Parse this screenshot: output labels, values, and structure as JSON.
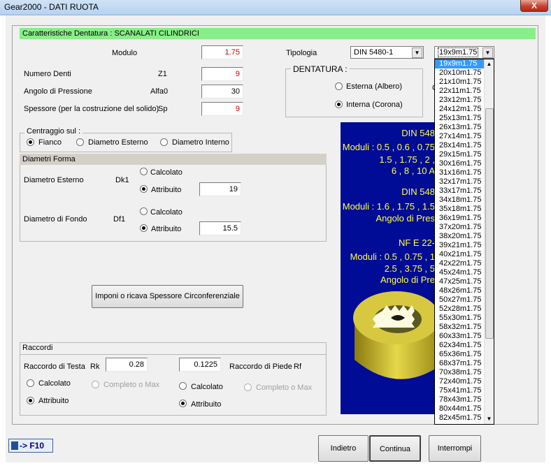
{
  "window": {
    "title": "Gear2000 - DATI RUOTA",
    "close_label": "X"
  },
  "header": {
    "section_title": "Caratteristiche Dentatura : SCANALATI CILINDRICI"
  },
  "fields": {
    "modulo": {
      "label": "Modulo",
      "value": "1.75"
    },
    "numero_denti": {
      "label": "Numero Denti",
      "symbol": "Z1",
      "value": "9"
    },
    "angolo_pressione": {
      "label": "Angolo di Pressione",
      "symbol": "Alfa0",
      "value": "30"
    },
    "spessore": {
      "label": "Spessore (per la costruzione del solido)",
      "symbol": "Sp",
      "value": "9"
    }
  },
  "tipologia": {
    "label": "Tipologia",
    "standard": "DIN 5480-1",
    "size": "19x9m1.75"
  },
  "dentatura": {
    "label": "DENTATURA :",
    "option_esterna": "Esterna (Albero)",
    "option_interna": "Interna (Corona)",
    "selected": "Interna (Corona)",
    "partial_label": "C"
  },
  "centraggio": {
    "label": "Centraggio sul :",
    "option_fianco": "Fianco",
    "option_esterno": "Diametro Esterno",
    "option_interno": "Diametro Interno",
    "selected": "Fianco"
  },
  "diametri": {
    "title": "Diametri Forma",
    "esterno": {
      "label": "Diametro Esterno",
      "symbol": "Dk1",
      "opt_calc": "Calcolato",
      "opt_attr": "Attribuito",
      "selected": "Attribuito",
      "value": "19"
    },
    "fondo": {
      "label": "Diametro di Fondo",
      "symbol": "Df1",
      "opt_calc": "Calcolato",
      "opt_attr": "Attribuito",
      "selected": "Attribuito",
      "value": "15.5"
    }
  },
  "imponi_button": "Imponi o ricava Spessore Circonferenziale",
  "raccordi": {
    "title": "Raccordi",
    "testa": {
      "label": "Raccordo di Testa",
      "symbol": "Rk",
      "value": "0.28",
      "opt_calc": "Calcolato",
      "opt_full": "Completo o Max",
      "opt_attr": "Attribuito",
      "selected": "Attribuito"
    },
    "piede": {
      "label": "Raccordo di Piede",
      "symbol": "Rf",
      "value": "0.1225",
      "opt_calc": "Calcolato",
      "opt_full": "Completo o Max",
      "opt_attr": "Attribuito",
      "selected": "Attribuito"
    }
  },
  "info_panel": {
    "l1": "DIN 548",
    "l2": "Moduli : 0.5 , 0.6 , 0.75",
    "l3": "1.5 , 1.75 , 2 ,",
    "l4": "6 , 8 , 10     A",
    "l5": "DIN 548",
    "l6": "Moduli : 1.6 , 1.75 , 1.5",
    "l7": "Angolo di Pres",
    "l8": "NF E 22-",
    "l9": "Moduli : 0.5 , 0.75 , 1",
    "l10": "2.5 , 3.75 , 5",
    "l11": "Angolo di Pre"
  },
  "f10_label": "-> F10",
  "buttons": {
    "back": "Indietro",
    "next": "Continua",
    "cancel": "Interrompi"
  },
  "size_options": [
    "19x9m1.75",
    "20x10m1.75",
    "21x10m1.75",
    "22x11m1.75",
    "23x12m1.75",
    "24x12m1.75",
    "25x13m1.75",
    "26x13m1.75",
    "27x14m1.75",
    "28x14m1.75",
    "29x15m1.75",
    "30x16m1.75",
    "31x16m1.75",
    "32x17m1.75",
    "33x17m1.75",
    "34x18m1.75",
    "35x18m1.75",
    "36x19m1.75",
    "37x20m1.75",
    "38x20m1.75",
    "39x21m1.75",
    "40x21m1.75",
    "42x22m1.75",
    "45x24m1.75",
    "47x25m1.75",
    "48x26m1.75",
    "50x27m1.75",
    "52x28m1.75",
    "55x30m1.75",
    "58x32m1.75",
    "60x33m1.75",
    "62x34m1.75",
    "65x36m1.75",
    "68x37m1.75",
    "70x38m1.75",
    "72x40m1.75",
    "75x41m1.75",
    "78x43m1.75",
    "80x44m1.75",
    "82x45m1.75"
  ],
  "colors": {
    "title_bar": "#b6d2ef",
    "green_header": "#88ee88",
    "info_panel": "#000c96",
    "info_text": "#ffff40",
    "highlight": "#3399ff",
    "value_red": "#d00000"
  }
}
